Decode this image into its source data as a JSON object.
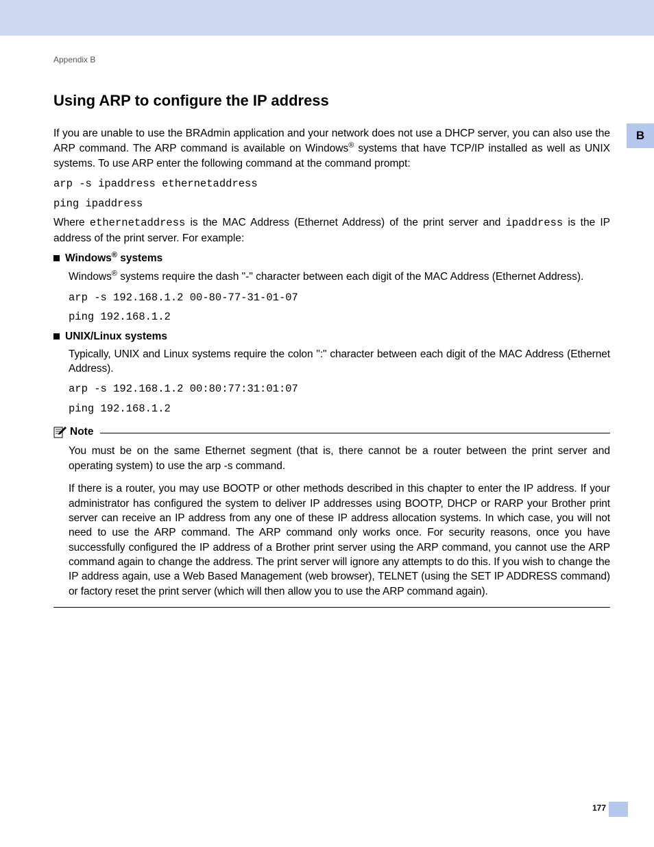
{
  "header": {
    "breadcrumb": "Appendix B",
    "side_tab": "B",
    "page_number": "177"
  },
  "title": "Using ARP to configure the IP address",
  "intro": {
    "part1": "If you are unable to use the BRAdmin application and your network does not use a DHCP server, you can also use the ARP command. The ARP command is available on Windows",
    "reg": "®",
    "part2": " systems that have TCP/IP installed as well as UNIX systems. To use ARP enter the following command at the command prompt:"
  },
  "cmd1": "arp -s ipaddress ethernetaddress",
  "cmd2": "ping ipaddress",
  "where": {
    "pre": "Where ",
    "code1": "ethernetaddress",
    "mid": " is the MAC Address (Ethernet Address) of the print server and ",
    "code2": "ipaddress",
    "post": " is the IP address of the print server. For example:"
  },
  "windows": {
    "label_pre": "Windows",
    "label_sup": "®",
    "label_post": " systems",
    "desc_pre": "Windows",
    "desc_sup": "®",
    "desc_post": " systems require the dash \"-\" character between each digit of the MAC Address (Ethernet Address).",
    "cmd1": "arp -s 192.168.1.2 00-80-77-31-01-07",
    "cmd2": "ping 192.168.1.2"
  },
  "unix": {
    "label": "UNIX/Linux systems",
    "desc": "Typically, UNIX and Linux systems require the colon \":\" character between each digit of the MAC Address (Ethernet Address).",
    "cmd1": "arp -s 192.168.1.2 00:80:77:31:01:07",
    "cmd2": "ping 192.168.1.2"
  },
  "note": {
    "title": "Note",
    "p1": "You must be on the same Ethernet segment (that is, there cannot be a router between the print server and operating system) to use the arp -s command.",
    "p2": "If there is a router, you may use BOOTP or other methods described in this chapter to enter the IP address. If your administrator has configured the system to deliver IP addresses using BOOTP, DHCP or RARP your Brother print server can receive an IP address from any one of these IP address allocation systems. In which case, you will not need to use the ARP command. The ARP command only works once. For security reasons, once you have successfully configured the IP address of a Brother print server using the ARP command, you cannot use the ARP command again to change the address. The print server will ignore any attempts to do this. If you wish to change the IP address again, use a Web Based Management (web browser), TELNET (using the SET IP ADDRESS command) or factory reset the print server (which will then allow you to use the ARP command again)."
  }
}
